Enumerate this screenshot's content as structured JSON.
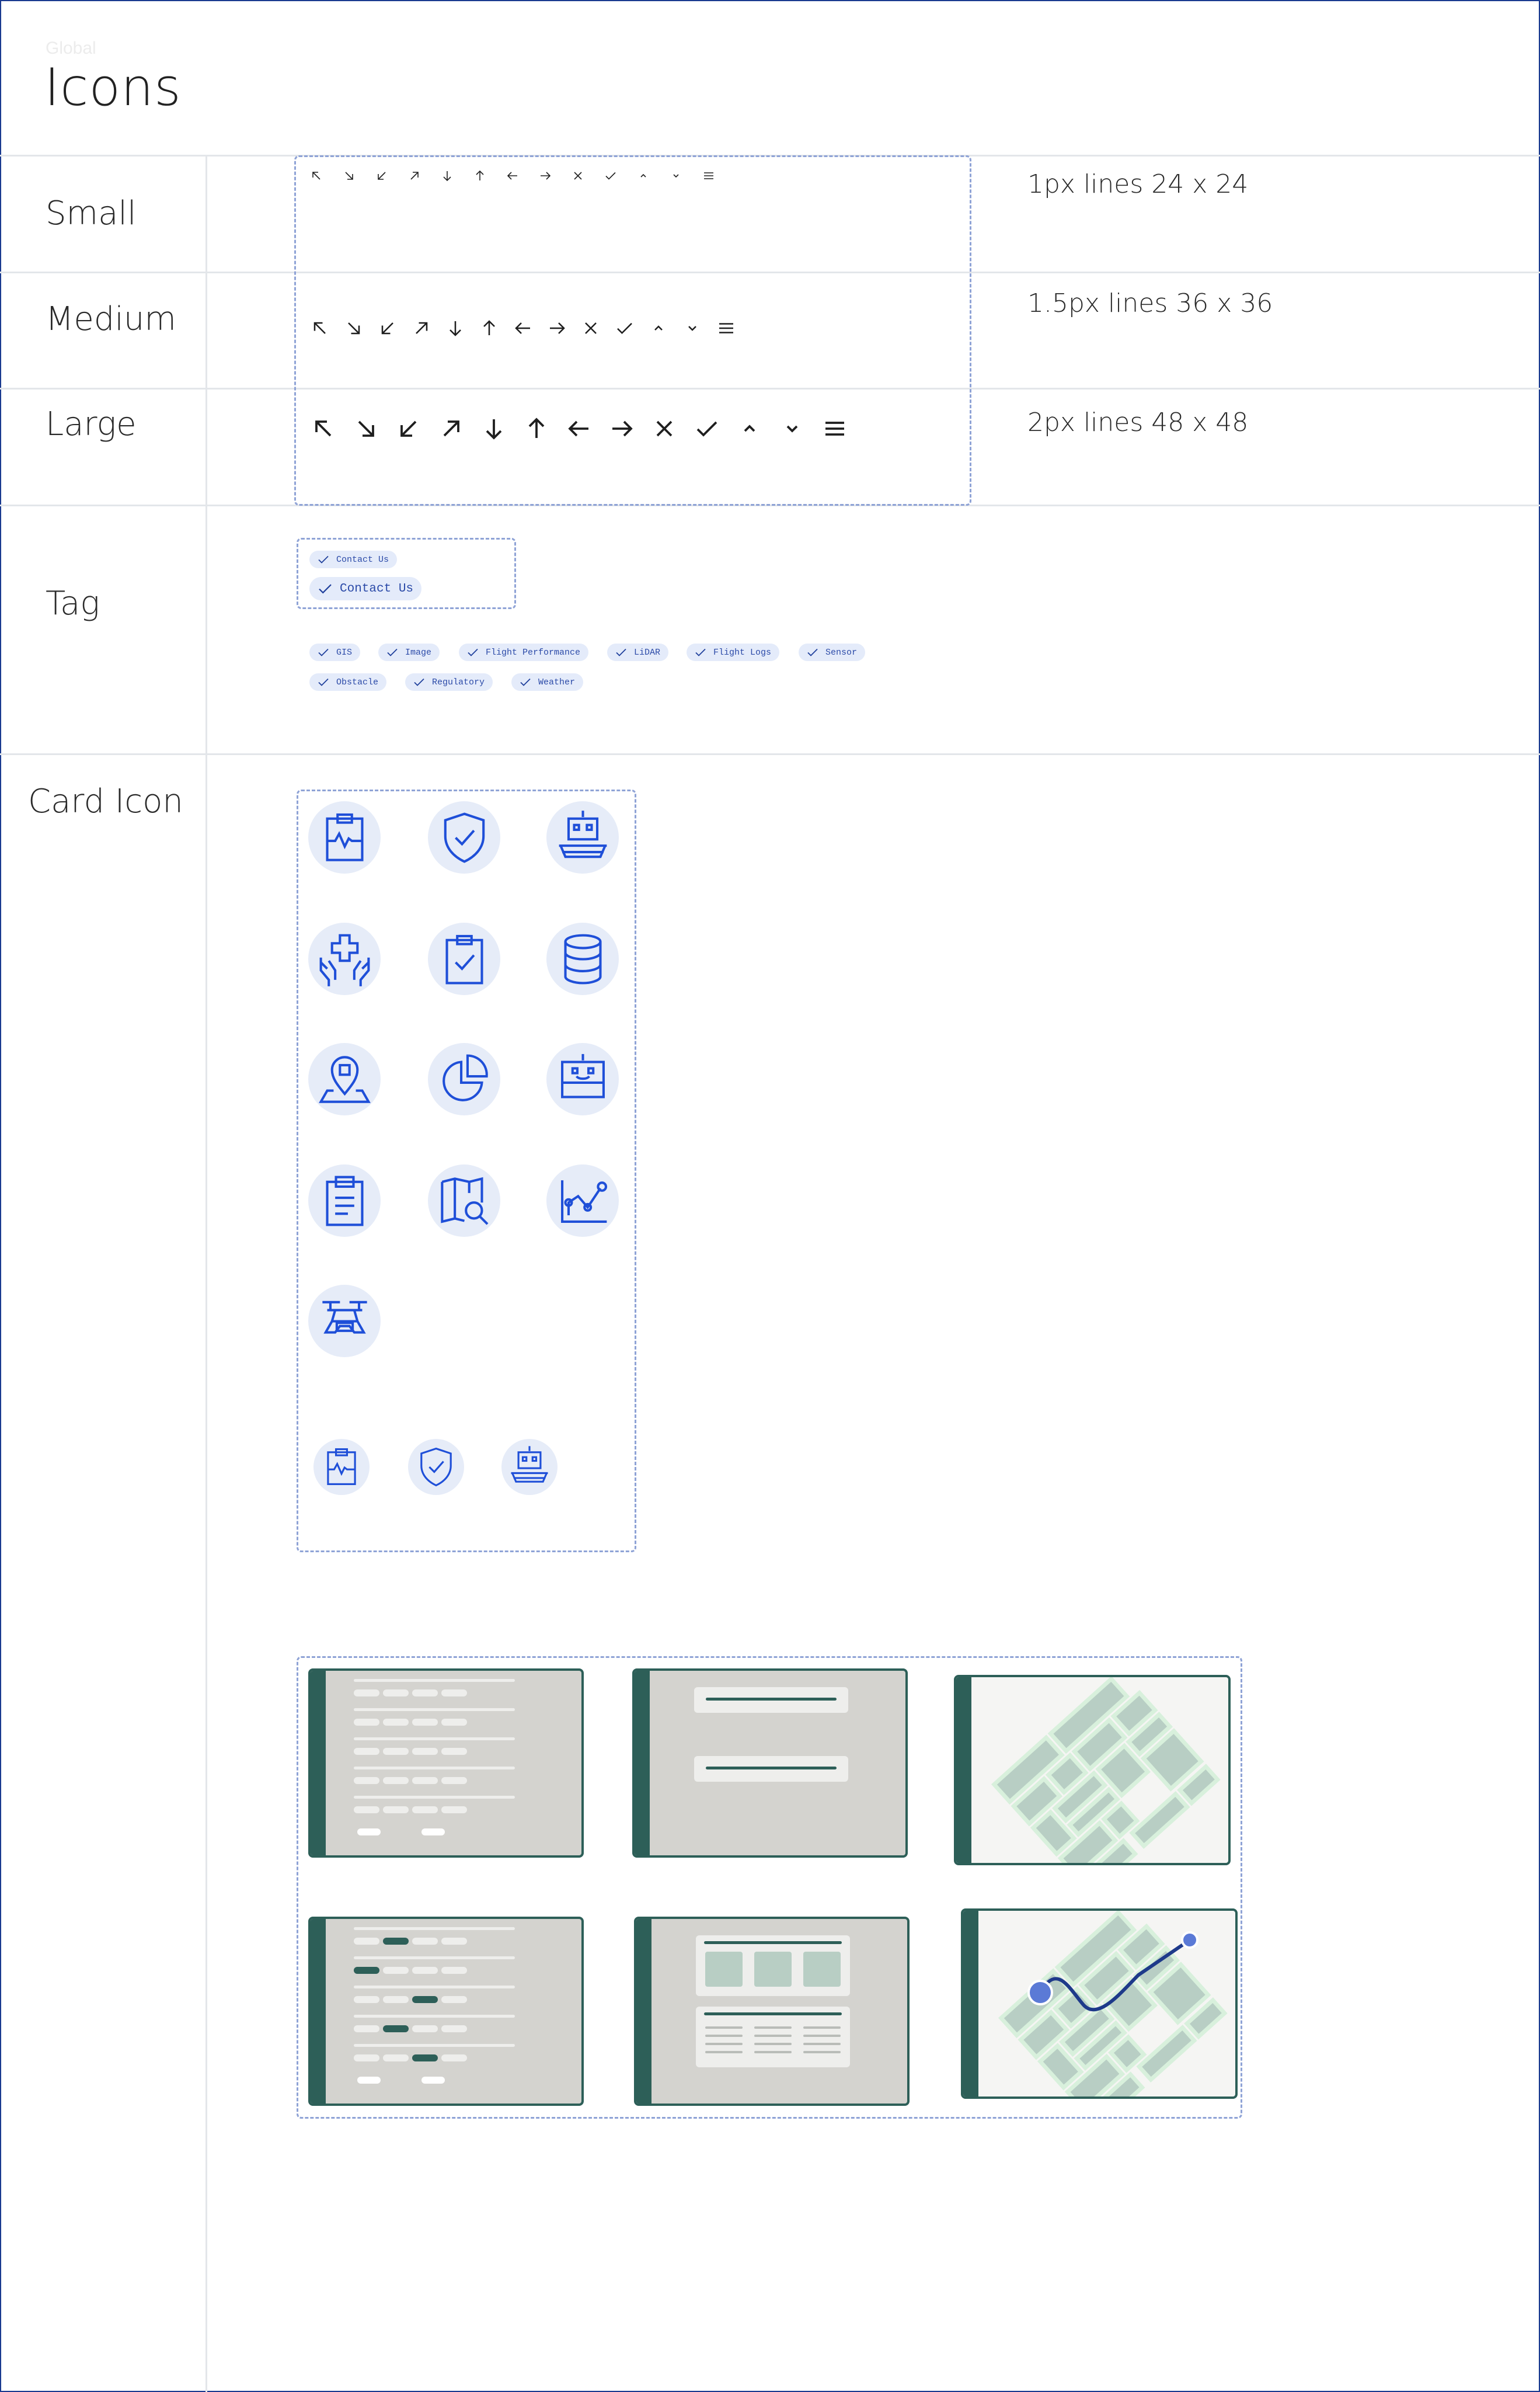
{
  "header": {
    "eyebrow": "Global",
    "title": "Icons"
  },
  "rows": {
    "small": {
      "label": "Small",
      "spec": "1px lines 24 x 24"
    },
    "medium": {
      "label": "Medium",
      "spec": "1.5px lines 36 x 36"
    },
    "large": {
      "label": "Large",
      "spec": "2px lines 48 x 48"
    },
    "tag": {
      "label": "Tag"
    },
    "card": {
      "label": "Card Icon"
    }
  },
  "icon_set": [
    "arrow-up-left-icon",
    "arrow-down-right-icon",
    "arrow-down-left-icon",
    "arrow-up-right-icon",
    "arrow-down-icon",
    "arrow-up-icon",
    "arrow-left-icon",
    "arrow-right-icon",
    "close-icon",
    "check-icon",
    "chevron-up-icon",
    "chevron-down-icon",
    "menu-icon"
  ],
  "tags": {
    "contact_small": "Contact Us",
    "contact_large": "Contact Us",
    "filters": [
      "GIS",
      "Image",
      "Flight Performance",
      "LiDAR",
      "Flight Logs",
      "Sensor",
      "Obstacle",
      "Regulatory",
      "Weather"
    ]
  },
  "card_icons": [
    "clipboard-pulse-icon",
    "shield-check-icon",
    "robot-tray-icon",
    "hands-medical-icon",
    "clipboard-check-icon",
    "database-icon",
    "map-pin-icon",
    "pie-chart-icon",
    "robot-face-icon",
    "clipboard-list-icon",
    "map-search-icon",
    "line-chart-icon",
    "drone-icon"
  ],
  "card_icons_small": [
    "clipboard-pulse-icon",
    "shield-check-icon",
    "robot-tray-icon"
  ],
  "colors": {
    "icon_blue": "#1f4fd8",
    "icon_bg": "#e6ecf8",
    "tag_bg": "#e4ebfa",
    "tag_text": "#2b4aa8",
    "thumb_green": "#2d5f58",
    "thumb_bg": "#d4d3cf",
    "dashed_border": "#8fa3d6",
    "map_block": "#b8cec4",
    "map_road": "#d8f0dc",
    "route_blue": "#5b7ad6"
  }
}
